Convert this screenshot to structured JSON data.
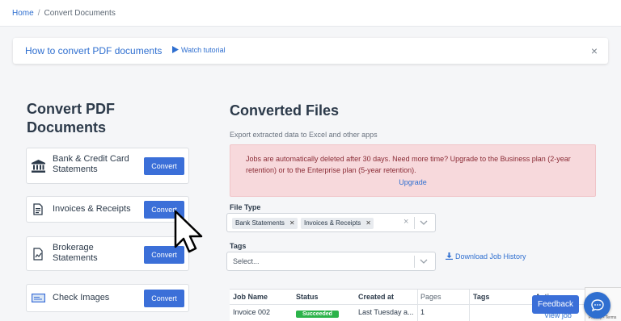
{
  "breadcrumb": {
    "home": "Home",
    "separator": "/",
    "current": "Convert Documents"
  },
  "banner": {
    "title": "How to convert PDF documents",
    "watch": "Watch tutorial",
    "close": "×"
  },
  "left": {
    "title": "Convert PDF Documents",
    "cards": [
      {
        "label": "Bank & Credit Card Statements",
        "button": "Convert",
        "icon": "bank-icon"
      },
      {
        "label": "Invoices & Receipts",
        "button": "Convert",
        "icon": "receipt-icon"
      },
      {
        "label": "Brokerage Statements",
        "button": "Convert",
        "icon": "brokerage-icon"
      },
      {
        "label": "Check Images",
        "button": "Convert",
        "icon": "check-icon"
      }
    ]
  },
  "right": {
    "title": "Converted Files",
    "subtitle": "Export extracted data to Excel and other apps",
    "alert": {
      "message": "Jobs are automatically deleted after 30 days. Need more time? Upgrade to the Business plan (2-year retention) or to the Enterprise plan (5-year retention).",
      "link": "Upgrade"
    },
    "file_type": {
      "label": "File Type",
      "chips": [
        "Bank Statements",
        "Invoices & Receipts"
      ],
      "clear": "×"
    },
    "tags": {
      "label": "Tags",
      "placeholder": "Select..."
    },
    "download": "Download Job History",
    "table": {
      "headers": [
        "Job Name",
        "Status",
        "Created at",
        "Pages",
        "Tags",
        "Actions"
      ],
      "rows": [
        {
          "name": "Invoice 002",
          "status": "Succeeded",
          "created": "Last Tuesday a...",
          "pages": "1",
          "action": "View job"
        }
      ]
    }
  },
  "feedback": "Feedback",
  "recaptcha": "Privacy - Terms",
  "colors": {
    "primary": "#3b6fd8",
    "link": "#2f6fd0",
    "success": "#2cb34a",
    "alert_bg": "#f7d9dc"
  }
}
